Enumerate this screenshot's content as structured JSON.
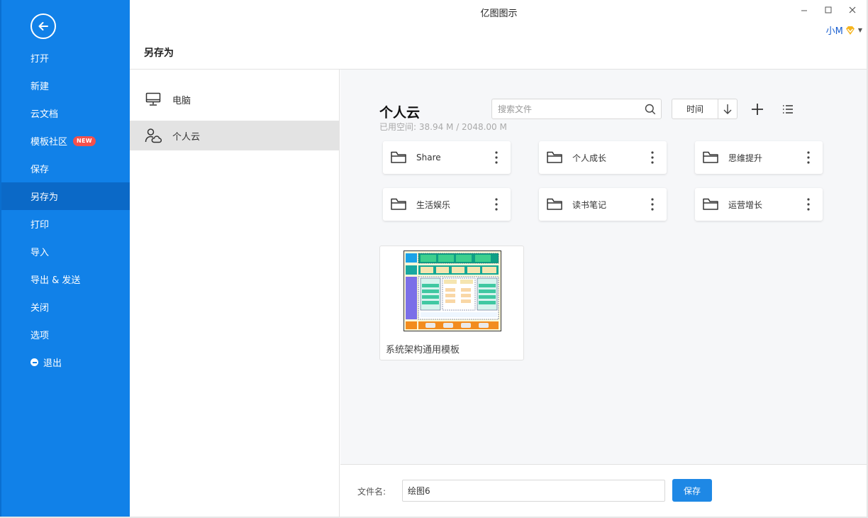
{
  "window": {
    "title": "亿图图示",
    "user_name": "小M"
  },
  "sidebar": {
    "items": [
      {
        "label": "打开"
      },
      {
        "label": "新建"
      },
      {
        "label": "云文档"
      },
      {
        "label": "模板社区",
        "badge": "NEW"
      },
      {
        "label": "保存"
      },
      {
        "label": "另存为"
      },
      {
        "label": "打印"
      },
      {
        "label": "导入"
      },
      {
        "label": "导出 & 发送"
      },
      {
        "label": "关闭"
      },
      {
        "label": "选项"
      },
      {
        "label": "退出"
      }
    ],
    "active": "另存为"
  },
  "page": {
    "title": "另存为"
  },
  "locations": [
    {
      "label": "电脑",
      "icon": "computer-icon"
    },
    {
      "label": "个人云",
      "icon": "person-cloud-icon",
      "active": true
    }
  ],
  "cloud": {
    "title": "个人云",
    "space": "已用空间:  38.94 M / 2048.00 M",
    "search_placeholder": "搜索文件",
    "sort_label": "时间"
  },
  "folders": [
    {
      "name": "Share"
    },
    {
      "name": "个人成长"
    },
    {
      "name": "思维提升"
    },
    {
      "name": "生活娱乐"
    },
    {
      "name": "读书笔记"
    },
    {
      "name": "运营增长"
    }
  ],
  "files": [
    {
      "name": "系统架构通用模板"
    }
  ],
  "bottom": {
    "filename_label": "文件名:",
    "filename_value": "绘图6",
    "save_label": "保存"
  },
  "colors": {
    "sidebar": "#1181e8",
    "sidebar_active": "#0b69c7",
    "accent": "#1e88e5",
    "badge": "#f5504c"
  }
}
